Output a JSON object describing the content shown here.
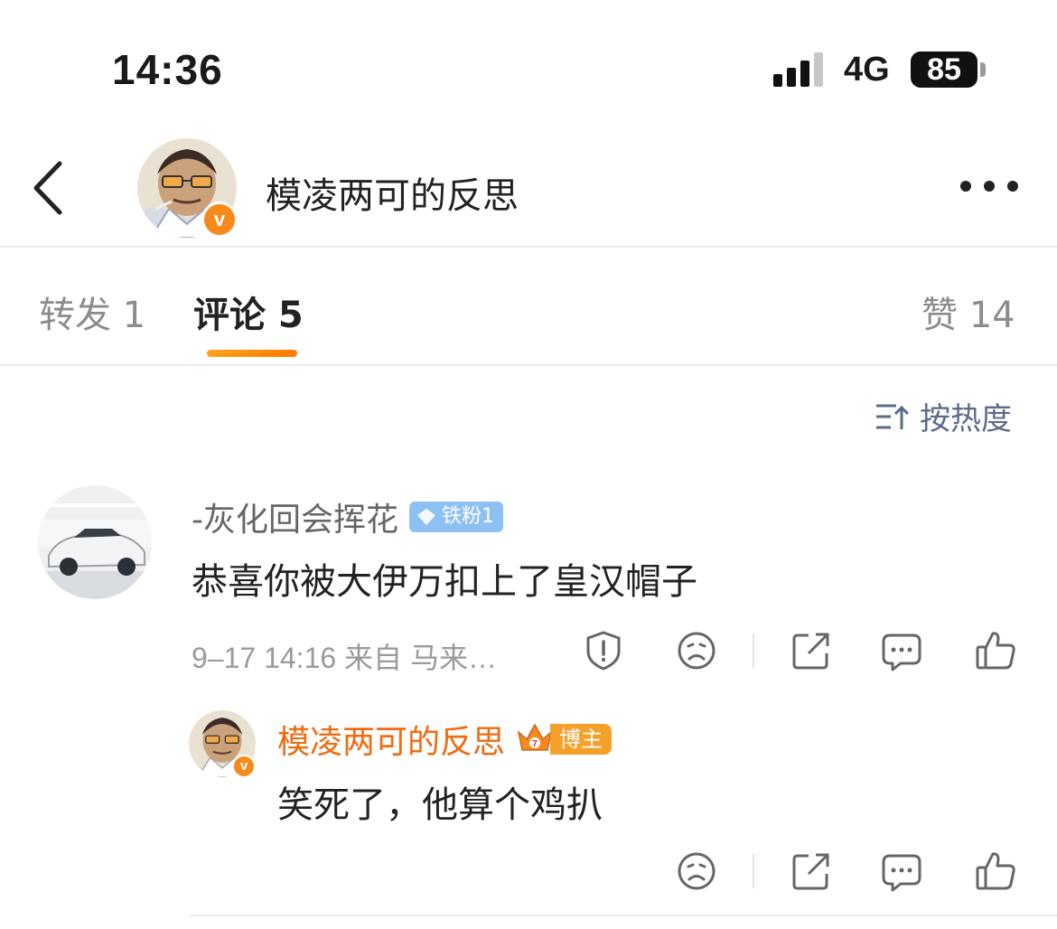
{
  "status_bar": {
    "time": "14:36",
    "network": "4G",
    "battery": "85"
  },
  "header": {
    "title": "模凌两可的反思",
    "verified_mark": "v"
  },
  "tabs": {
    "repost": "转发 1",
    "comments": "评论 5",
    "likes": "赞 14"
  },
  "sort": {
    "label": "按热度"
  },
  "comment": {
    "username": "-灰化回会挥花",
    "fan_badge": "铁粉1",
    "text": "恭喜你被大伊万扣上了皇汉帽子",
    "meta": "9–17 14:16  来自  马来…"
  },
  "reply": {
    "username": "模凌两可的反思",
    "badge": "博主",
    "badge_level": "7",
    "verified_mark": "v",
    "text": "笑死了，他算个鸡扒"
  },
  "colors": {
    "accent": "#f06a0f",
    "tab_underline": "#ff8a00",
    "sort": "#5b6b8a",
    "fan_badge": "#8ec1f3",
    "host_badge": "#f4a12c"
  },
  "icons": [
    "back-arrow-icon",
    "more-dots-icon",
    "sort-icon",
    "report-icon",
    "dislike-face-icon",
    "share-icon",
    "comment-icon",
    "like-icon",
    "diamond-icon",
    "crown-icon"
  ]
}
